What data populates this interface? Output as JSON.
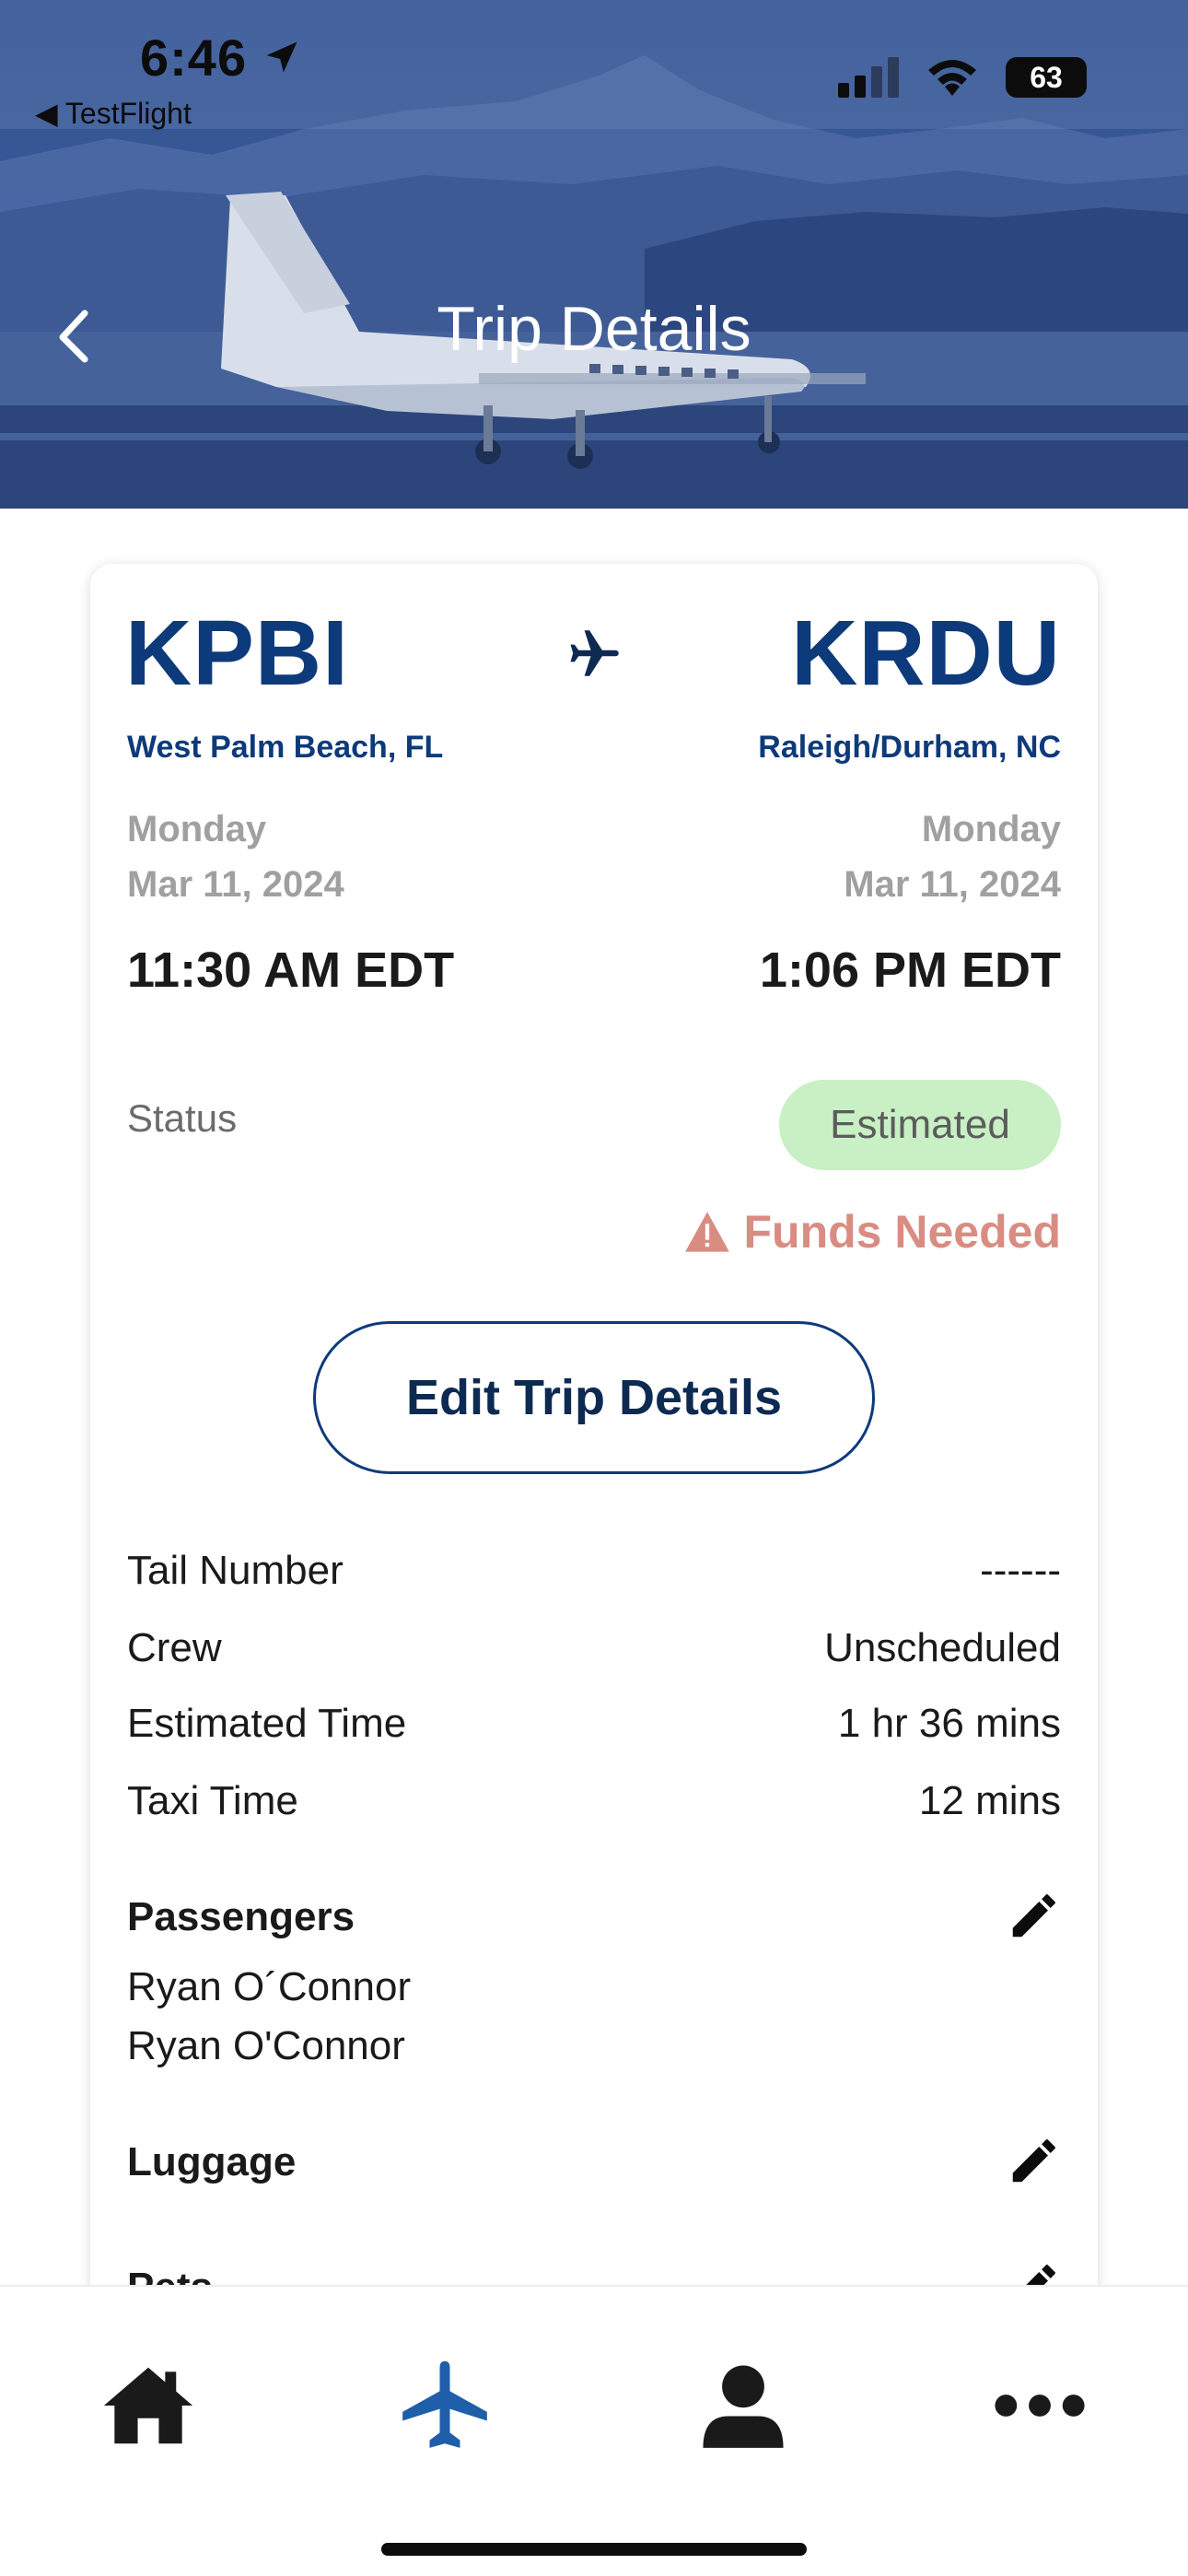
{
  "status_bar": {
    "time": "6:46",
    "back_app": "TestFlight",
    "battery": "63"
  },
  "header": {
    "title": "Trip Details",
    "back_icon": "chevron-left-icon"
  },
  "trip": {
    "origin": {
      "code": "KPBI",
      "city": "West Palm Beach, FL",
      "day": "Monday",
      "date": "Mar 11, 2024",
      "time": "11:30 AM EDT"
    },
    "destination": {
      "code": "KRDU",
      "city": "Raleigh/Durham, NC",
      "day": "Monday",
      "date": "Mar 11, 2024",
      "time": "1:06 PM EDT"
    },
    "status_label": "Status",
    "status_value": "Estimated",
    "alert": "Funds Needed",
    "edit_button": "Edit Trip Details",
    "details": [
      {
        "label": "Tail Number",
        "value": "------"
      },
      {
        "label": "Crew",
        "value": "Unscheduled"
      },
      {
        "label": "Estimated Time",
        "value": "1 hr 36 mins"
      },
      {
        "label": "Taxi Time",
        "value": "12 mins"
      }
    ],
    "passengers_title": "Passengers",
    "passengers": [
      "Ryan O´Connor",
      "Ryan O'Connor"
    ],
    "luggage_title": "Luggage",
    "pets_title": "Pets"
  },
  "tabs": [
    {
      "name": "home",
      "icon": "home-icon"
    },
    {
      "name": "trips",
      "icon": "airplane-icon",
      "active": true
    },
    {
      "name": "profile",
      "icon": "person-icon"
    },
    {
      "name": "more",
      "icon": "more-icon"
    }
  ],
  "colors": {
    "primary": "#0d3a7a",
    "badge_bg": "#c8f0c4",
    "alert": "#d98c82",
    "tab_active": "#1f5ea8",
    "tab_inactive": "#1a1a1a"
  }
}
